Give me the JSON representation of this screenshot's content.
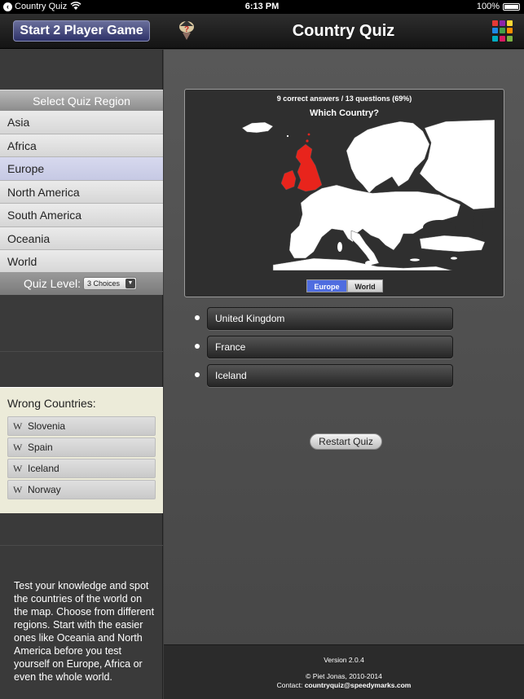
{
  "status_bar": {
    "app_name": "Country Quiz",
    "time": "6:13 PM",
    "battery": "100%"
  },
  "header": {
    "two_player_label": "Start 2 Player Game",
    "title": "Country Quiz",
    "grid_colors": [
      "#e53935",
      "#8e24aa",
      "#fdd835",
      "#1e88e5",
      "#43a047",
      "#fb8c00",
      "#00acc1",
      "#d81b60",
      "#7cb342"
    ]
  },
  "sidebar": {
    "region_header": "Select Quiz Region",
    "regions": [
      "Asia",
      "Africa",
      "Europe",
      "North America",
      "South America",
      "Oceania",
      "World"
    ],
    "selected_region": "Europe",
    "quiz_level_label": "Quiz Level:",
    "quiz_level_value": "3 Choices",
    "wrong_title": "Wrong Countries:",
    "wrong_countries": [
      "Slovenia",
      "Spain",
      "Iceland",
      "Norway"
    ],
    "description": "Test your knowledge and spot the countries of the world on the map. Choose from different regions. Start with the easier ones like Oceania and North America before you test yourself on Europe, Africa or even the whole world."
  },
  "quiz": {
    "score": "9 correct answers / 13 questions (69%)",
    "question": "Which Country?",
    "map_tabs": [
      "Europe",
      "World"
    ],
    "active_map_tab": "Europe",
    "highlight_color": "#e8241c",
    "answers": [
      "United Kingdom",
      "France",
      "Iceland"
    ],
    "restart_label": "Restart Quiz"
  },
  "footer": {
    "version": "Version 2.0.4",
    "copyright": "© Piet Jonas, 2010-2014",
    "contact_label": "Contact:",
    "contact_email": "countryquiz@speedymarks.com"
  }
}
